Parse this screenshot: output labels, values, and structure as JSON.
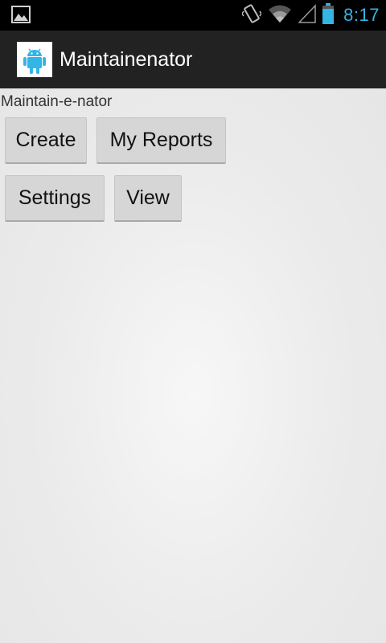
{
  "status_bar": {
    "time": "8:17",
    "accent_color": "#33b5e5",
    "icons": [
      "gallery-notification-icon",
      "vibrate-icon",
      "wifi-icon",
      "signal-icon",
      "battery-icon"
    ]
  },
  "action_bar": {
    "title": "Maintainenator",
    "icon": "android-robot-icon"
  },
  "main": {
    "heading": "Maintain-e-nator",
    "buttons": {
      "create": "Create",
      "my_reports": "My Reports",
      "settings": "Settings",
      "view": "View"
    }
  }
}
